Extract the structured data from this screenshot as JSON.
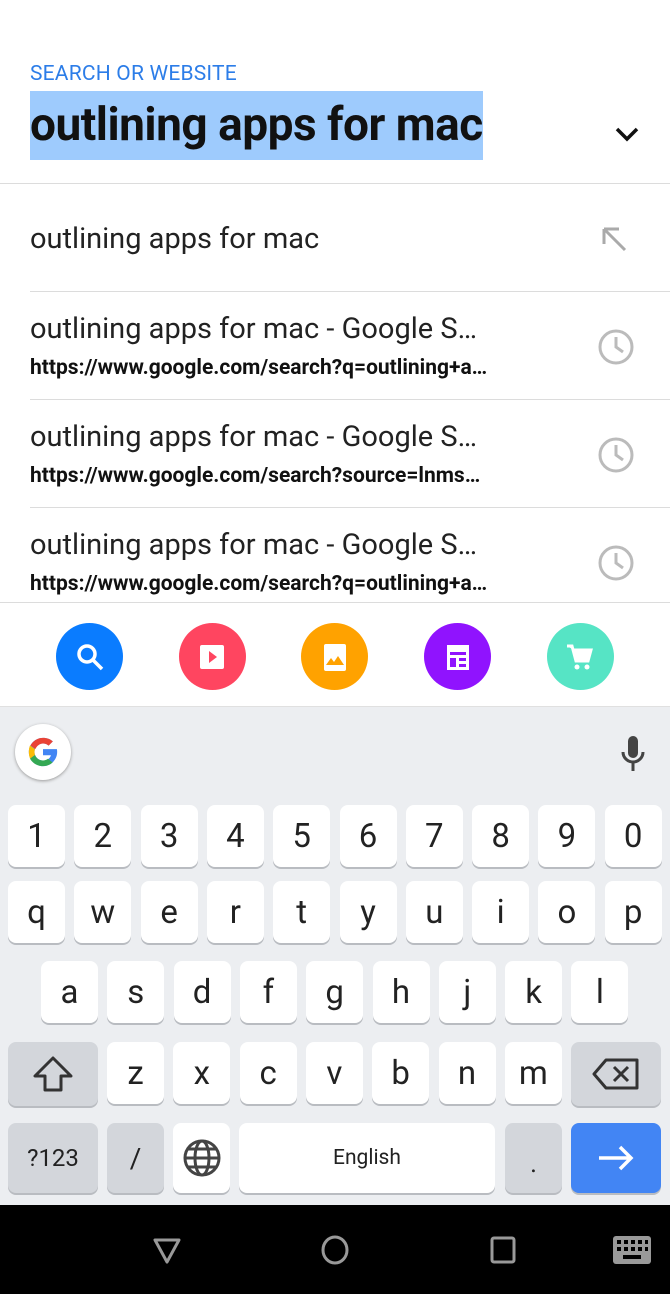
{
  "search": {
    "label": "SEARCH OR WEBSITE",
    "value": "outlining apps for mac"
  },
  "suggestion": {
    "text": "outlining apps for mac",
    "icon": "arrow-up-left-icon"
  },
  "history": [
    {
      "title": "outlining apps for mac - Google S…",
      "url": "https://www.google.com/search?q=outlining+a…"
    },
    {
      "title": "outlining apps for mac - Google S…",
      "url": "https://www.google.com/search?source=lnms…"
    },
    {
      "title": "outlining apps for mac - Google S…",
      "url": "https://www.google.com/search?q=outlining+a…"
    }
  ],
  "shortcuts": [
    {
      "name": "search",
      "color": "#0a7cff"
    },
    {
      "name": "video",
      "color": "#ff4560"
    },
    {
      "name": "image",
      "color": "#ffa200"
    },
    {
      "name": "news",
      "color": "#9013fe"
    },
    {
      "name": "shopping",
      "color": "#56e4c5"
    }
  ],
  "keyboard": {
    "rows": [
      [
        "1",
        "2",
        "3",
        "4",
        "5",
        "6",
        "7",
        "8",
        "9",
        "0"
      ],
      [
        "q",
        "w",
        "e",
        "r",
        "t",
        "y",
        "u",
        "i",
        "o",
        "p"
      ],
      [
        "a",
        "s",
        "d",
        "f",
        "g",
        "h",
        "j",
        "k",
        "l"
      ],
      [
        "z",
        "x",
        "c",
        "v",
        "b",
        "n",
        "m"
      ]
    ],
    "symbols": "?123",
    "slash": "/",
    "space": "English",
    "period": ".",
    "accent": "#4285f4"
  }
}
